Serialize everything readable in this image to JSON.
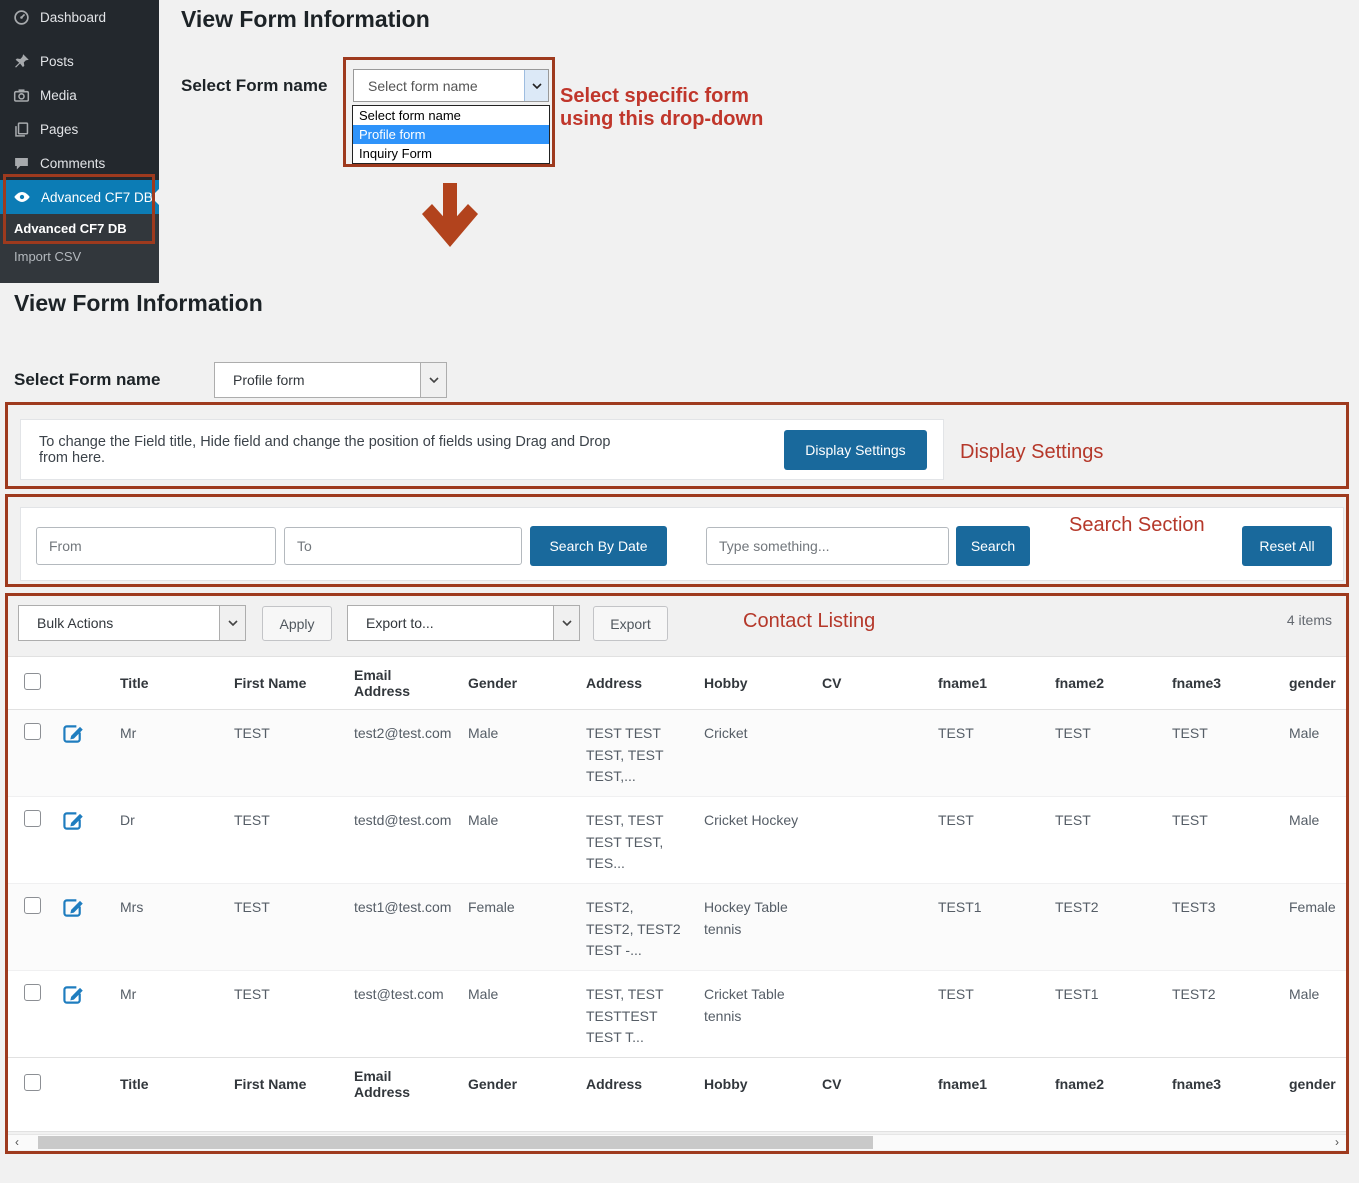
{
  "colors": {
    "annotation_border": "#9e3a1e",
    "annotation_text": "#b5382a",
    "primary_button_blue": "#19699c",
    "active_menu_blue": "#0c7cb5",
    "dropdown_highlight_blue": "#2e93fa"
  },
  "sidebar": {
    "items": [
      {
        "label": "Dashboard",
        "icon": "dashboard-icon"
      },
      {
        "label": "Posts",
        "icon": "pin-icon"
      },
      {
        "label": "Media",
        "icon": "camera-icon"
      },
      {
        "label": "Pages",
        "icon": "pages-icon"
      },
      {
        "label": "Comments",
        "icon": "comment-icon"
      },
      {
        "label": "Advanced CF7 DB",
        "icon": "eye-icon",
        "active": true
      }
    ],
    "submenu": [
      {
        "label": "Advanced CF7 DB",
        "current": true
      },
      {
        "label": "Import CSV",
        "current": false
      }
    ]
  },
  "top_panel": {
    "title": "View Form Information",
    "select_label": "Select Form name",
    "dropdown_value": "Select form name",
    "dropdown_options": [
      "Select form name",
      "Profile form",
      "Inquiry Form"
    ],
    "highlighted_option": "Profile form"
  },
  "annotations": {
    "dropdown_note_line1": "Select specific form",
    "dropdown_note_line2": "using this drop-down",
    "display_settings": "Display Settings",
    "search_section": "Search Section",
    "contact_listing": "Contact Listing"
  },
  "main_panel": {
    "title": "View Form Information",
    "select_label": "Select Form name",
    "form_select_value": "Profile form",
    "display_settings": {
      "note": "To change the Field title, Hide field and change the position of fields using Drag and Drop from here.",
      "button_label": "Display Settings"
    },
    "search": {
      "from_placeholder": "From",
      "to_placeholder": "To",
      "search_by_date_label": "Search By Date",
      "keyword_placeholder": "Type something...",
      "search_label": "Search",
      "reset_label": "Reset All"
    },
    "toolbar": {
      "bulk_actions_value": "Bulk Actions",
      "apply_label": "Apply",
      "export_to_value": "Export to...",
      "export_label": "Export",
      "items_count": "4 items"
    },
    "table": {
      "columns": [
        "Title",
        "First Name",
        "Email Address",
        "Gender",
        "Address",
        "Hobby",
        "CV",
        "fname1",
        "fname2",
        "fname3",
        "gender"
      ],
      "rows": [
        {
          "title": "Mr",
          "first_name": "TEST",
          "email": "test2@test.com",
          "gender": "Male",
          "address": "TEST TEST TEST, TEST TEST,...",
          "hobby": "Cricket",
          "cv": "",
          "fname1": "TEST",
          "fname2": "TEST",
          "fname3": "TEST",
          "gender2": "Male"
        },
        {
          "title": "Dr",
          "first_name": "TEST",
          "email": "testd@test.com",
          "gender": "Male",
          "address": "TEST, TEST TEST TEST, TES...",
          "hobby": "Cricket Hockey",
          "cv": "",
          "fname1": "TEST",
          "fname2": "TEST",
          "fname3": "TEST",
          "gender2": "Male"
        },
        {
          "title": "Mrs",
          "first_name": "TEST",
          "email": "test1@test.com",
          "gender": "Female",
          "address": "TEST2, TEST2, TEST2 TEST -...",
          "hobby": "Hockey Table tennis",
          "cv": "",
          "fname1": "TEST1",
          "fname2": "TEST2",
          "fname3": "TEST3",
          "gender2": "Female"
        },
        {
          "title": "Mr",
          "first_name": "TEST",
          "email": "test@test.com",
          "gender": "Male",
          "address": "TEST, TEST TESTTEST TEST T...",
          "hobby": "Cricket Table tennis",
          "cv": "",
          "fname1": "TEST",
          "fname2": "TEST1",
          "fname3": "TEST2",
          "gender2": "Male"
        }
      ]
    }
  }
}
